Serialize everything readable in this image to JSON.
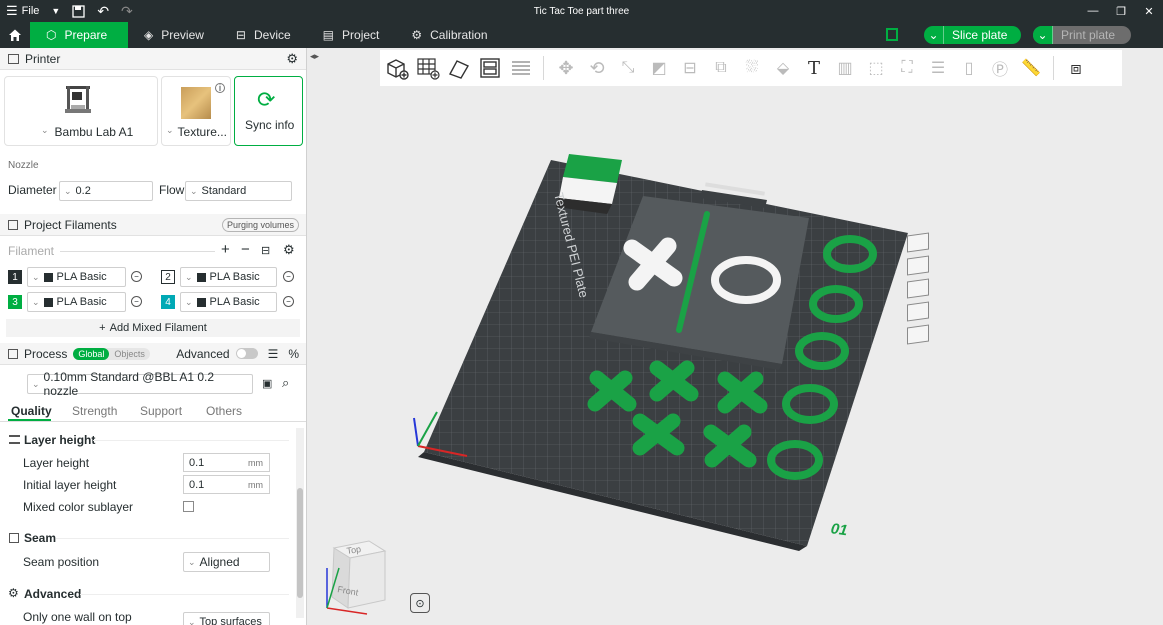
{
  "titlebar": {
    "file_label": "File",
    "window_title": "Tic Tac Toe part three"
  },
  "topbar": {
    "tabs": [
      {
        "label": "Prepare",
        "icon": "cube-icon"
      },
      {
        "label": "Preview",
        "icon": "layers-icon"
      },
      {
        "label": "Device",
        "icon": "device-icon"
      },
      {
        "label": "Project",
        "icon": "project-icon"
      },
      {
        "label": "Calibration",
        "icon": "calibration-icon"
      }
    ],
    "slice_label": "Slice plate",
    "print_label": "Print plate"
  },
  "printer": {
    "header": "Printer",
    "printer_name": "Bambu Lab A1",
    "plate_name": "Texture...",
    "sync_label": "Sync info",
    "nozzle_label": "Nozzle",
    "diameter_label": "Diameter",
    "diameter_value": "0.2",
    "flow_label": "Flow",
    "flow_value": "Standard"
  },
  "filaments": {
    "header": "Project Filaments",
    "purging_label": "Purging volumes",
    "filament_label": "Filament",
    "items": [
      {
        "num": "1",
        "name": "PLA Basic",
        "color": "#262e30"
      },
      {
        "num": "2",
        "name": "PLA Basic",
        "color": "#ffffff"
      },
      {
        "num": "3",
        "name": "PLA Basic",
        "color": "#00ae42"
      },
      {
        "num": "4",
        "name": "PLA Basic",
        "color": "#00a9b5"
      }
    ],
    "add_mixed_label": "Add Mixed Filament"
  },
  "process": {
    "header": "Process",
    "global_label": "Global",
    "objects_label": "Objects",
    "advanced_label": "Advanced",
    "preset": "0.10mm Standard @BBL A1 0.2 nozzle",
    "subtabs": [
      "Quality",
      "Strength",
      "Support",
      "Others"
    ],
    "sections": {
      "layer_height": "Layer height",
      "seam": "Seam",
      "advanced": "Advanced"
    },
    "layer_height_label": "Layer height",
    "layer_height_value": "0.1",
    "initial_layer_label": "Initial layer height",
    "initial_layer_value": "0.1",
    "unit": "mm",
    "mixed_sublayer_label": "Mixed color sublayer",
    "seam_position_label": "Seam position",
    "seam_position_value": "Aligned",
    "one_wall_label": "Only one wall on top",
    "one_wall_value": "Top surfaces"
  },
  "viewport": {
    "plate_text": "Textured PEI Plate",
    "plate_number": "01",
    "cube_top": "Top",
    "cube_front": "Front"
  },
  "colors": {
    "accent": "#00ae42",
    "dark": "#262e30",
    "plate": "#3b3f42",
    "piece": "#1aa246"
  }
}
